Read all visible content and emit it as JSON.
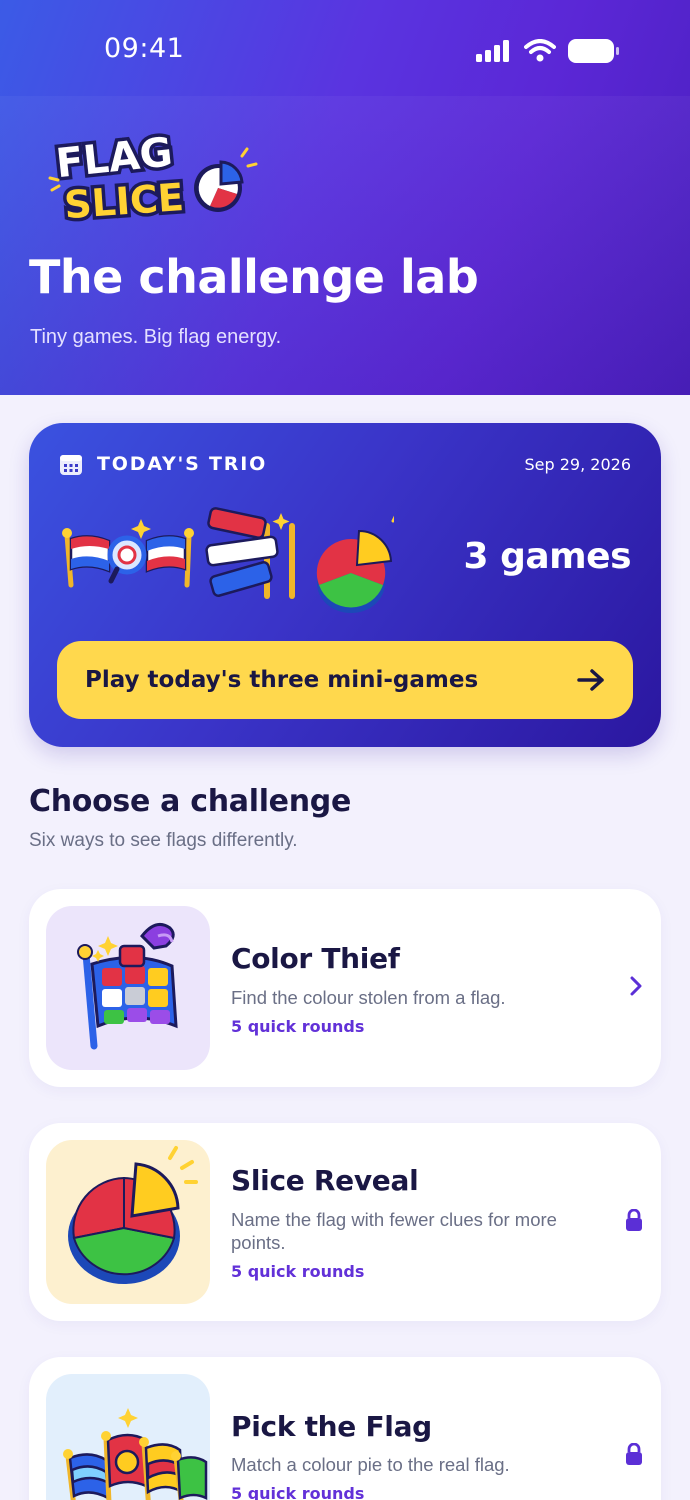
{
  "status_bar": {
    "time": "09:41"
  },
  "header": {
    "logo": {
      "line1": "FLAG",
      "line2": "SLICE"
    },
    "title": "The challenge lab",
    "subtitle": "Tiny games. Big flag energy."
  },
  "trio": {
    "label": "TODAY'S TRIO",
    "date": "Sep 29, 2026",
    "count": "3 games",
    "button_label": "Play today's three mini-games"
  },
  "challenges_section": {
    "title": "Choose a challenge",
    "subtitle": "Six ways to see flags differently."
  },
  "challenges": [
    {
      "title": "Color Thief",
      "description": "Find the colour stolen from a flag.",
      "meta": "5 quick rounds",
      "status": "open",
      "thumb_bg": "#ece5fb"
    },
    {
      "title": "Slice Reveal",
      "description": "Name the flag with fewer clues for more points.",
      "meta": "5 quick rounds",
      "status": "locked",
      "thumb_bg": "#fdf0cf"
    },
    {
      "title": "Pick the Flag",
      "description": "Match a colour pie to the real flag.",
      "meta": "5 quick rounds",
      "status": "locked",
      "thumb_bg": "#e2effc"
    }
  ],
  "colors": {
    "accent": "#6231d8",
    "button_yellow": "#ffd84d",
    "text_dark": "#1a1744",
    "text_muted": "#6a6f86"
  }
}
